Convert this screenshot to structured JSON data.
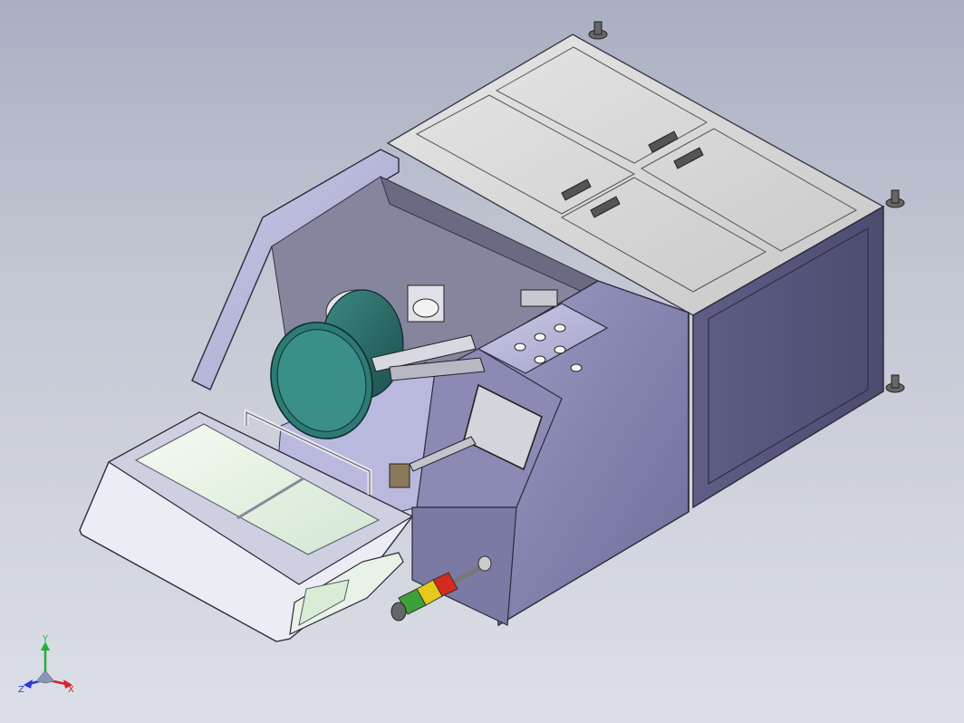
{
  "viewport": {
    "background_top": "#a9afc1",
    "background_bottom": "#dcdfe7"
  },
  "model": {
    "body_color": "#8f8fb8",
    "cabinet_color": "#dcdcdc",
    "bowl_color": "#2a6e6a",
    "panel_dark": "#4a4a66"
  },
  "signal_tower": {
    "colors": [
      "#d62a1e",
      "#e6c81c",
      "#3ea03a"
    ]
  },
  "axis_triad": {
    "x_label": "X",
    "y_label": "Y",
    "z_label": "Z",
    "x_color": "#d8202a",
    "y_color": "#22b03a",
    "z_color": "#2a3ad8"
  }
}
